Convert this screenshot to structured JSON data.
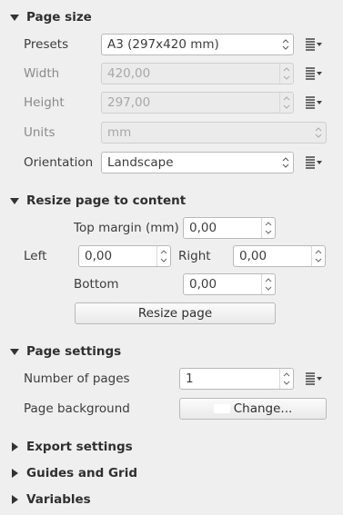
{
  "page_size": {
    "title": "Page size",
    "presets": {
      "label": "Presets",
      "value": "A3 (297x420 mm)"
    },
    "width": {
      "label": "Width",
      "value": "420,00"
    },
    "height": {
      "label": "Height",
      "value": "297,00"
    },
    "units": {
      "label": "Units",
      "value": "mm"
    },
    "orientation": {
      "label": "Orientation",
      "value": "Landscape"
    }
  },
  "resize": {
    "title": "Resize page to content",
    "top_margin": {
      "label": "Top margin (mm)",
      "value": "0,00"
    },
    "left": {
      "label": "Left",
      "value": "0,00"
    },
    "right": {
      "label": "Right",
      "value": "0,00"
    },
    "bottom": {
      "label": "Bottom",
      "value": "0,00"
    },
    "button": "Resize page"
  },
  "page_settings": {
    "title": "Page settings",
    "num_pages": {
      "label": "Number of pages",
      "value": "1"
    },
    "background": {
      "label": "Page background",
      "button": "Change..."
    }
  },
  "collapsed_sections": {
    "export": "Export settings",
    "guides": "Guides and Grid",
    "variables": "Variables"
  },
  "icons": {
    "expanded": "triangle-down-icon",
    "collapsed": "triangle-right-icon",
    "data_defined": "data-defined-override-icon"
  },
  "colors": {
    "background": "#efefef",
    "field_border": "#b9b9b9"
  }
}
